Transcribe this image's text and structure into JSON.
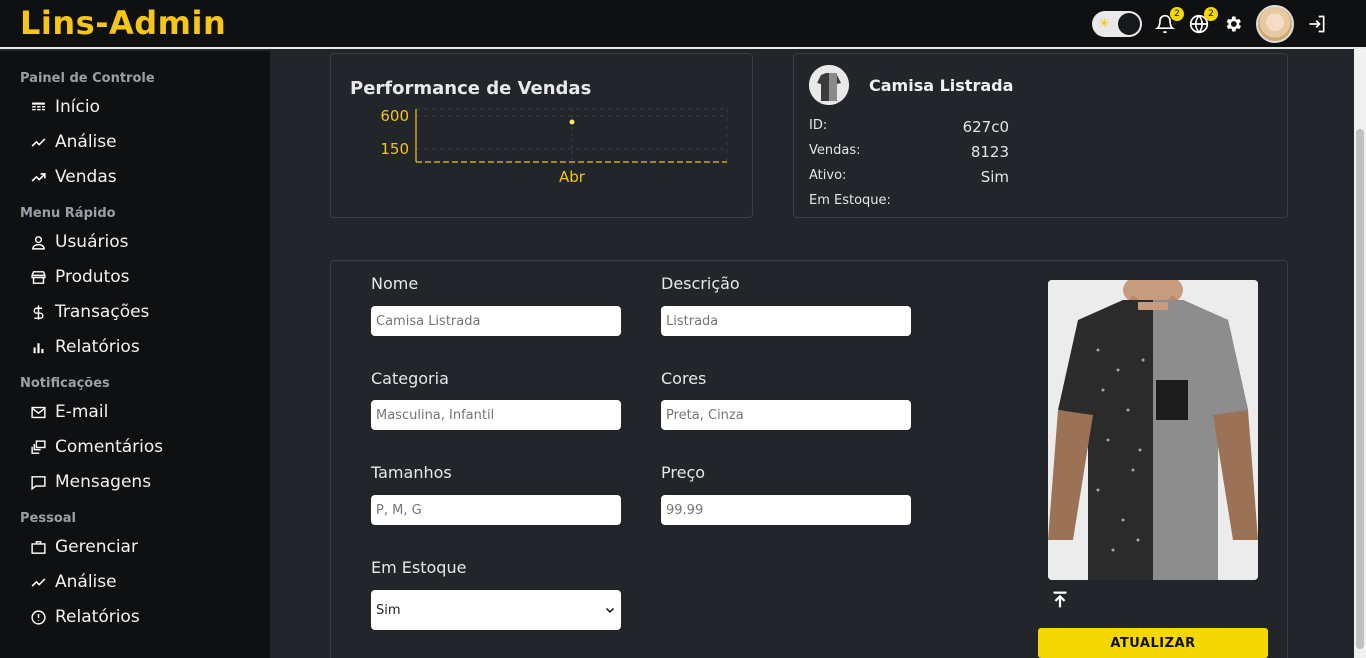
{
  "app": {
    "title": "Lins-Admin"
  },
  "header": {
    "notifications_count": "2",
    "language_count": "2"
  },
  "sidebar": {
    "sections": [
      {
        "title": "Painel de Controle",
        "items": [
          "Início",
          "Análise",
          "Vendas"
        ]
      },
      {
        "title": "Menu Rápido",
        "items": [
          "Usuários",
          "Produtos",
          "Transações",
          "Relatórios"
        ]
      },
      {
        "title": "Notificações",
        "items": [
          "E-mail",
          "Comentários",
          "Mensagens"
        ]
      },
      {
        "title": "Pessoal",
        "items": [
          "Gerenciar",
          "Análise",
          "Relatórios"
        ]
      }
    ]
  },
  "chart": {
    "title": "Performance de Vendas",
    "colors": {
      "axis": "#f5c518",
      "grid": "#3a3e45",
      "point": "#f5e27a"
    }
  },
  "chart_data": {
    "type": "line",
    "title": "Performance de Vendas",
    "categories": [
      "Abr"
    ],
    "y_ticks": [
      "600",
      "150"
    ],
    "series": [
      {
        "values": [
          600
        ]
      }
    ],
    "ylim": [
      0,
      750
    ],
    "grid": true
  },
  "product": {
    "name": "Camisa Listrada",
    "fields": [
      {
        "label": "ID:",
        "value": "627c0"
      },
      {
        "label": "Vendas:",
        "value": "8123"
      },
      {
        "label": "Ativo:",
        "value": "Sim"
      },
      {
        "label": "Em Estoque:",
        "value": ""
      }
    ]
  },
  "form": {
    "nome_label": "Nome",
    "nome_placeholder": "Camisa Listrada",
    "descricao_label": "Descrição",
    "descricao_placeholder": "Listrada",
    "categoria_label": "Categoria",
    "categoria_placeholder": "Masculina, Infantil",
    "cores_label": "Cores",
    "cores_placeholder": "Preta, Cinza",
    "tamanhos_label": "Tamanhos",
    "tamanhos_placeholder": "P, M, G",
    "preco_label": "Preço",
    "preco_placeholder": "99.99",
    "estoque_label": "Em Estoque",
    "estoque_value": "Sim",
    "update_label": "ATUALIZAR"
  },
  "colors": {
    "accent": "#f5c518",
    "button": "#f5d800",
    "background": "#22252a",
    "sidebar": "#0f1012"
  }
}
